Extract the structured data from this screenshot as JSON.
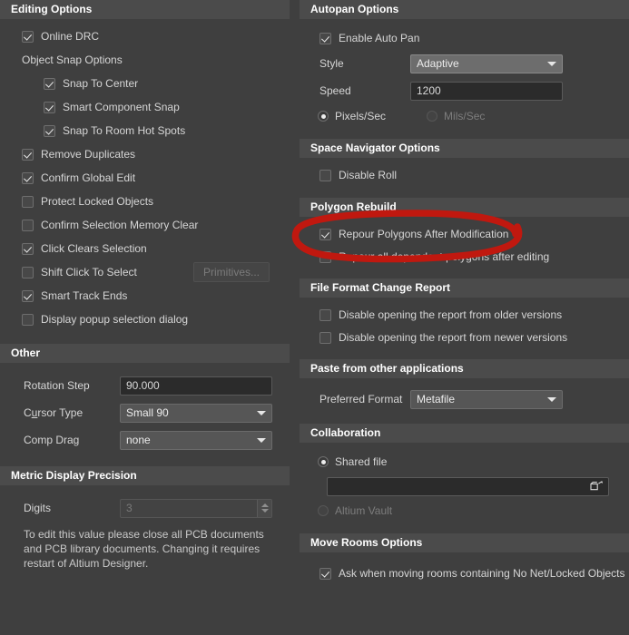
{
  "left": {
    "editing": {
      "title": "Editing Options",
      "online_drc": "Online DRC",
      "object_snap_options": "Object Snap Options",
      "snap_to_center": "Snap To Center",
      "smart_component_snap": "Smart Component Snap",
      "snap_to_room_hot_spots": "Snap To Room Hot Spots",
      "remove_duplicates": "Remove Duplicates",
      "confirm_global_edit": "Confirm Global Edit",
      "protect_locked_objects": "Protect Locked Objects",
      "confirm_selection_memory_clear": "Confirm Selection Memory Clear",
      "click_clears_selection": "Click Clears Selection",
      "shift_click_to_select": "Shift Click To Select",
      "primitives_button": "Primitives...",
      "smart_track_ends": "Smart Track Ends",
      "display_popup_selection_dialog": "Display popup selection dialog"
    },
    "other": {
      "title": "Other",
      "rotation_step_label": "Rotation Step",
      "rotation_step_value": "90.000",
      "cursor_type_label_a": "C",
      "cursor_type_label_u": "u",
      "cursor_type_label_b": "rsor Type",
      "cursor_type_value": "Small 90",
      "comp_drag_label": "Comp Drag",
      "comp_drag_value": "none"
    },
    "metric": {
      "title": "Metric Display Precision",
      "digits_label": "Digits",
      "digits_value": "3",
      "note": "To edit this value please close all PCB documents and PCB library documents. Changing it requires restart of Altium Designer."
    }
  },
  "right": {
    "autopan": {
      "title": "Autopan Options",
      "enable_auto_pan": "Enable Auto Pan",
      "style_label": "Style",
      "style_value": "Adaptive",
      "speed_label": "Speed",
      "speed_value": "1200",
      "pixels_per_sec": "Pixels/Sec",
      "mils_per_sec": "Mils/Sec"
    },
    "space_navigator": {
      "title": "Space Navigator Options",
      "disable_roll": "Disable Roll"
    },
    "polygon_rebuild": {
      "title": "Polygon Rebuild",
      "repour_after_modification": "Repour Polygons After Modification",
      "repour_dependent": "Repour all dependent polygons after editing"
    },
    "file_format": {
      "title": "File Format Change Report",
      "disable_older": "Disable opening the report from older versions",
      "disable_newer": "Disable opening the report from newer versions"
    },
    "paste": {
      "title": "Paste from other applications",
      "preferred_format_label": "Preferred Format",
      "preferred_format_value": "Metafile"
    },
    "collaboration": {
      "title": "Collaboration",
      "shared_file": "Shared file",
      "shared_file_path": "",
      "altium_vault": "Altium Vault"
    },
    "move_rooms": {
      "title": "Move Rooms Options",
      "ask_when_moving": "Ask when moving rooms containing No Net/Locked Objects"
    }
  },
  "annotation": {
    "color": "#c0180f",
    "shape": "ellipse",
    "target": "Repour Polygons After Modification"
  },
  "theme": {
    "background": "#3f3f3f",
    "header_bar": "#4b4b4b",
    "text": "#d6d6d6",
    "field_bg": "#2b2b2b",
    "combo_bg": "#565656"
  }
}
